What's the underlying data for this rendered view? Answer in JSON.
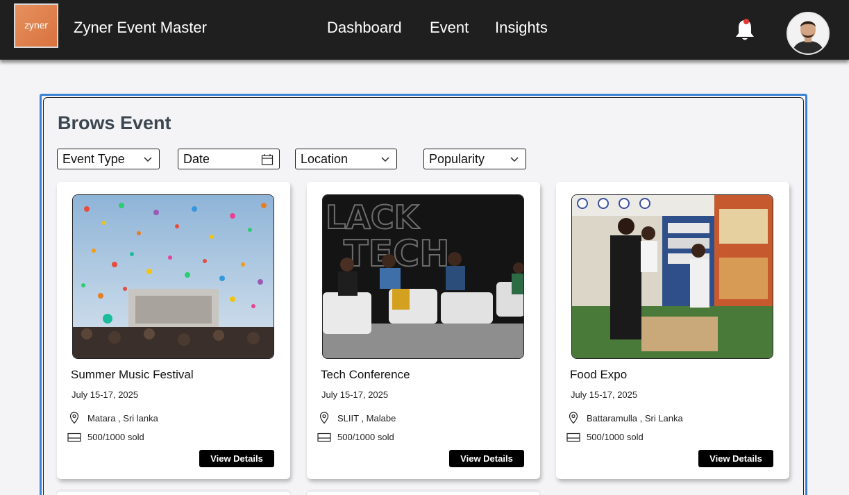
{
  "header": {
    "logo_text": "zyner",
    "app_title": "Zyner Event Master",
    "nav": [
      "Dashboard",
      "Event",
      "Insights"
    ],
    "bell_icon": "bell-icon",
    "notification_color": "#e53935"
  },
  "main": {
    "title": "Brows Event",
    "filters": [
      "Event Type",
      "Date",
      "Location",
      "Popularity"
    ],
    "view_details_label": "View Details",
    "cards": [
      {
        "title": "Summer Music Festival",
        "date": "July 15-17, 2025",
        "location": "Matara , Sri lanka",
        "sold": "500/1000  sold"
      },
      {
        "title": "Tech Conference",
        "date": "July 15-17, 2025",
        "location": "SLIIT , Malabe",
        "sold": "500/1000  sold"
      },
      {
        "title": "Food Expo",
        "date": "July 15-17, 2025",
        "location": "Battaramulla , Sri Lanka",
        "sold": "500/1000  sold"
      }
    ]
  },
  "colors": {
    "navbar": "#1f1f20",
    "accent_border": "#3b82d6",
    "button": "#000000"
  }
}
